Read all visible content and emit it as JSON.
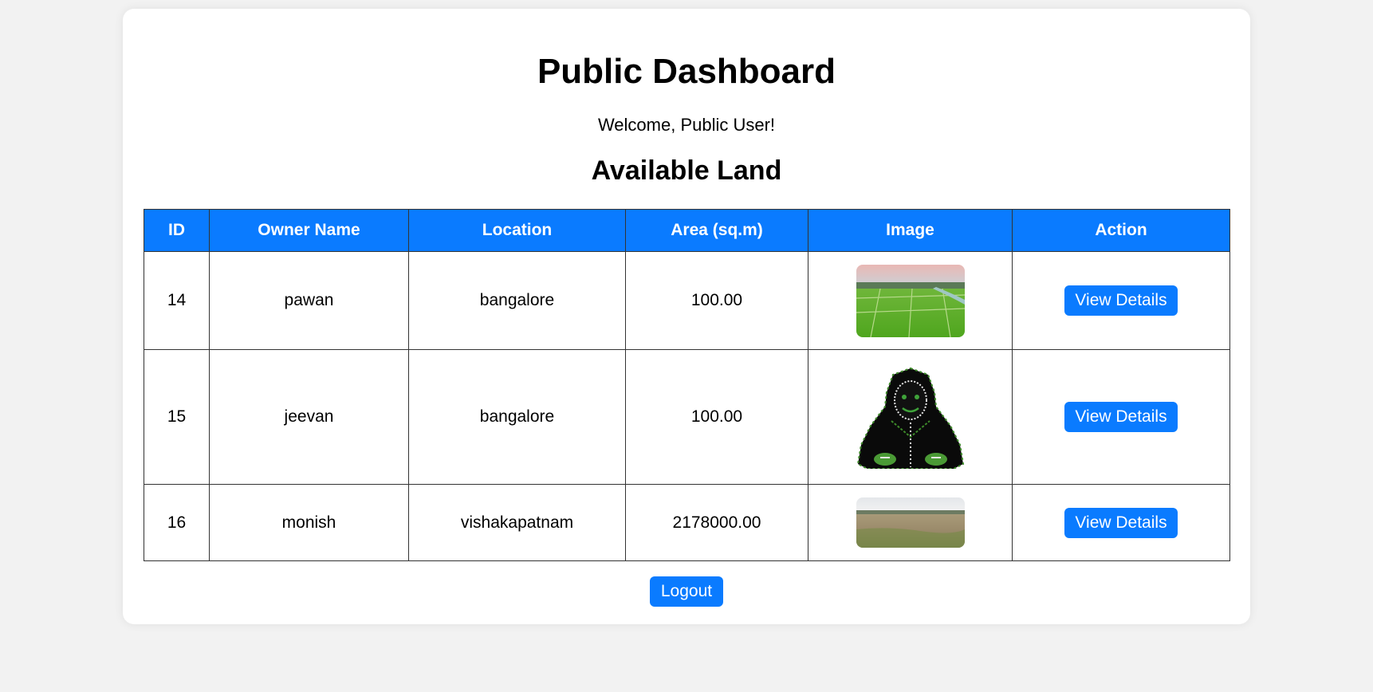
{
  "header": {
    "title": "Public Dashboard",
    "welcome": "Welcome, Public User!",
    "section_title": "Available Land"
  },
  "table": {
    "columns": [
      "ID",
      "Owner Name",
      "Location",
      "Area (sq.m)",
      "Image",
      "Action"
    ],
    "rows": [
      {
        "id": "14",
        "owner": "pawan",
        "location": "bangalore",
        "area": "100.00",
        "image": "green-farmland-photo",
        "action": "View Details"
      },
      {
        "id": "15",
        "owner": "jeevan",
        "location": "bangalore",
        "area": "100.00",
        "image": "hooded-figure-pixel-art",
        "action": "View Details"
      },
      {
        "id": "16",
        "owner": "monish",
        "location": "vishakapatnam",
        "area": "2178000.00",
        "image": "dry-grassland-photo",
        "action": "View Details"
      }
    ]
  },
  "footer": {
    "logout_label": "Logout"
  },
  "colors": {
    "accent": "#0a7bff",
    "background": "#f2f2f2",
    "card": "#ffffff"
  }
}
